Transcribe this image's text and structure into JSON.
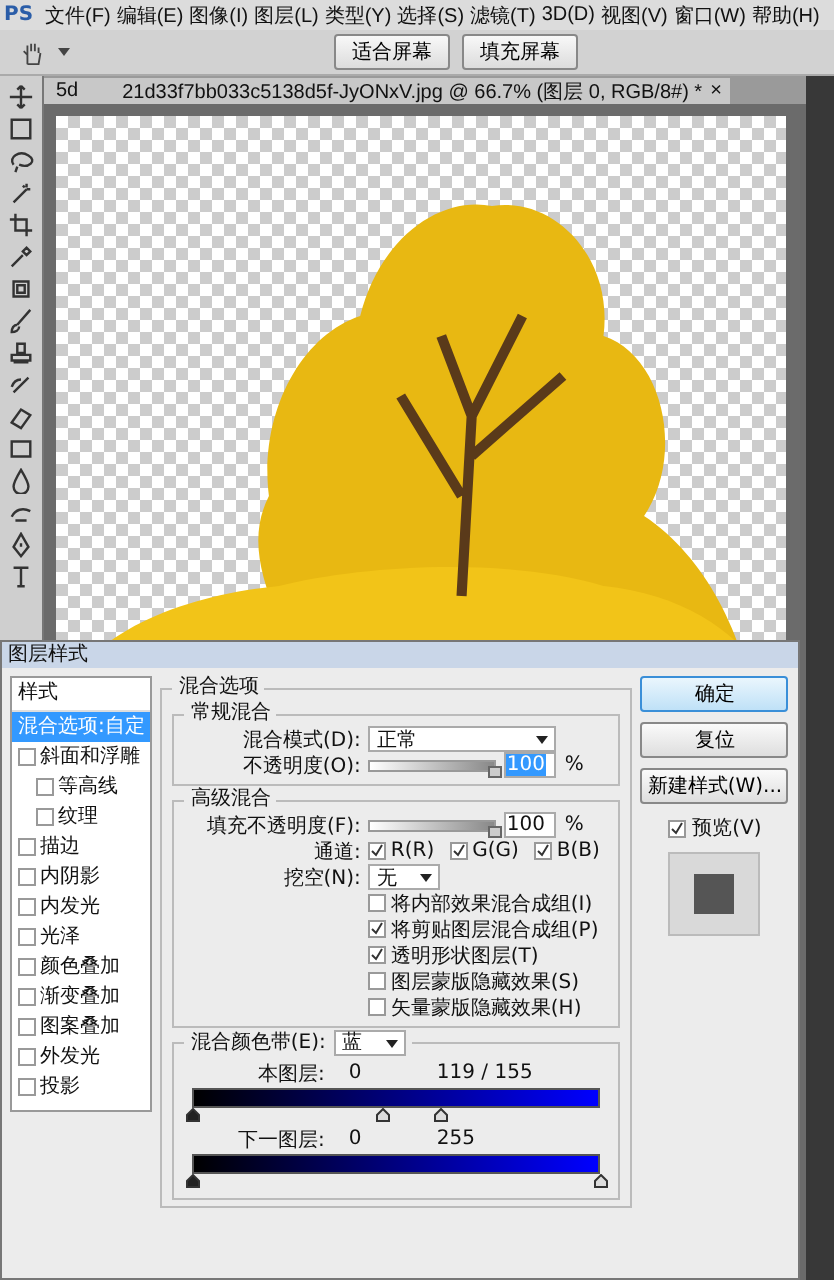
{
  "menu_bar": {
    "logo": "PS",
    "items": [
      "文件(F)",
      "编辑(E)",
      "图像(I)",
      "图层(L)",
      "类型(Y)",
      "选择(S)",
      "滤镜(T)",
      "3D(D)",
      "视图(V)",
      "窗口(W)",
      "帮助(H)"
    ]
  },
  "options_bar": {
    "buttons": [
      "适合屏幕",
      "填充屏幕"
    ]
  },
  "document_tab": {
    "title_start": "5d",
    "title_end": "21d33f7bb033c5138d5f-JyONxV.jpg @ 66.7% (图层 0, RGB/8#) *",
    "close": "×"
  },
  "dialog": {
    "title": "图层样式",
    "styles_header": "样式",
    "styles": [
      {
        "label": "混合选项:自定",
        "kind": "option",
        "selected": true
      },
      {
        "label": "斜面和浮雕",
        "kind": "effect",
        "checked": false,
        "selected": false,
        "children": [
          {
            "label": "等高线",
            "kind": "effect",
            "checked": false,
            "selected": false
          },
          {
            "label": "纹理",
            "kind": "effect",
            "checked": false,
            "selected": false
          }
        ]
      },
      {
        "label": "描边",
        "kind": "effect",
        "checked": false,
        "selected": false
      },
      {
        "label": "内阴影",
        "kind": "effect",
        "checked": false,
        "selected": false
      },
      {
        "label": "内发光",
        "kind": "effect",
        "checked": false,
        "selected": false
      },
      {
        "label": "光泽",
        "kind": "effect",
        "checked": false,
        "selected": false
      },
      {
        "label": "颜色叠加",
        "kind": "effect",
        "checked": false,
        "selected": false
      },
      {
        "label": "渐变叠加",
        "kind": "effect",
        "checked": false,
        "selected": false
      },
      {
        "label": "图案叠加",
        "kind": "effect",
        "checked": false,
        "selected": false
      },
      {
        "label": "外发光",
        "kind": "effect",
        "checked": false,
        "selected": false
      },
      {
        "label": "投影",
        "kind": "effect",
        "checked": false,
        "selected": false
      }
    ],
    "blending": {
      "title": "混合选项",
      "general": {
        "title": "常规混合",
        "mode_label": "混合模式(D):",
        "mode": "正常",
        "opacity_label": "不透明度(O):",
        "opacity": {
          "level": 1,
          "value": "100",
          "unit": "%",
          "focused": true
        }
      },
      "advanced": {
        "title": "高级混合",
        "fill_label": "填充不透明度(F):",
        "fill": {
          "level": 1,
          "value": "100",
          "unit": "%",
          "focused": false
        },
        "channels_label": "通道:",
        "channels": [
          {
            "label": "R(R)",
            "checked": true
          },
          {
            "label": "G(G)",
            "checked": true
          },
          {
            "label": "B(B)",
            "checked": true
          }
        ],
        "knockout_label": "挖空(N):",
        "knockout": "无",
        "options": [
          {
            "label": "将内部效果混合成组(I)",
            "checked": false
          },
          {
            "label": "将剪贴图层混合成组(P)",
            "checked": true
          },
          {
            "label": "透明形状图层(T)",
            "checked": true
          },
          {
            "label": "图层蒙版隐藏效果(S)",
            "checked": false
          },
          {
            "label": "矢量蒙版隐藏效果(H)",
            "checked": false
          }
        ]
      },
      "blend_if": {
        "label": "混合颜色带(E):",
        "channel": "蓝",
        "layers": [
          {
            "label": "本图层:",
            "low": "0",
            "high": "119 / 155",
            "thumbs": [
              {
                "level": 0
              },
              {
                "level": 0.467
              },
              {
                "level": 0.608
              }
            ]
          },
          {
            "label": "下一图层:",
            "low": "0",
            "high": "255",
            "thumbs": [
              {
                "level": 0
              },
              {
                "level": 1
              }
            ]
          }
        ]
      }
    },
    "buttons": [
      {
        "label": "确定",
        "default": true
      },
      {
        "label": "复位",
        "default": false
      },
      {
        "label": "新建样式(W)...",
        "default": false
      }
    ],
    "preview": {
      "label": "预览(V)",
      "checked": true
    }
  }
}
